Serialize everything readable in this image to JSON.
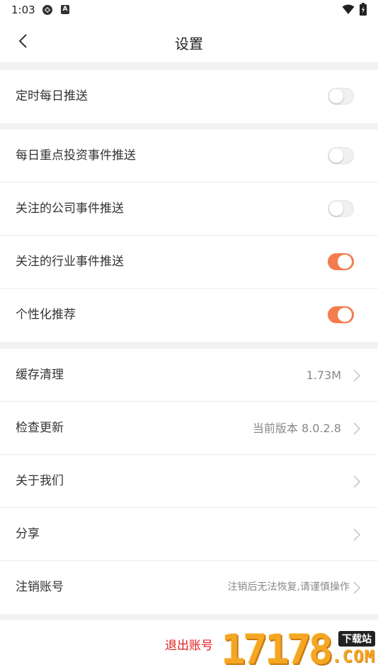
{
  "status_bar": {
    "time": "1:03",
    "icons": [
      "sync-icon",
      "a-badge-icon",
      "wifi-icon",
      "battery-icon"
    ]
  },
  "navbar": {
    "title": "设置",
    "back_icon": "chevron-left-icon"
  },
  "groups": [
    {
      "rows": [
        {
          "label": "定时每日推送",
          "toggle": false
        }
      ]
    },
    {
      "rows": [
        {
          "label": "每日重点投资事件推送",
          "toggle": false
        },
        {
          "label": "关注的公司事件推送",
          "toggle": false
        },
        {
          "label": "关注的行业事件推送",
          "toggle": true
        },
        {
          "label": "个性化推荐",
          "toggle": true
        }
      ]
    },
    {
      "rows": [
        {
          "label": "缓存清理",
          "value": "1.73M"
        },
        {
          "label": "检查更新",
          "value": "当前版本 8.0.2.8"
        },
        {
          "label": "关于我们",
          "value": ""
        },
        {
          "label": "分享",
          "value": ""
        },
        {
          "label": "注销账号",
          "value": "注销后无法恢复,请谨慎操作"
        }
      ]
    }
  ],
  "logout": {
    "label": "退出账号"
  },
  "watermark": {
    "digits": "17178",
    "tag": "下载站",
    "domain": ".COM"
  },
  "colors": {
    "accent": "#f47c4d",
    "logout": "#e02020",
    "background": "#f2f2f2"
  }
}
